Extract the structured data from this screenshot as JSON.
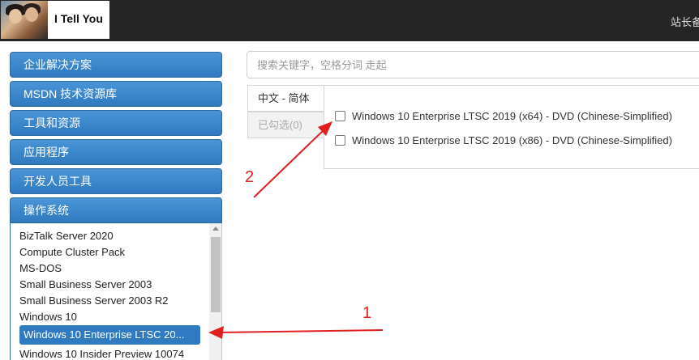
{
  "header": {
    "logo_text": "I Tell You",
    "right_text": "站长备"
  },
  "sidebar": {
    "categories": [
      {
        "label": "企业解决方案"
      },
      {
        "label": "MSDN 技术资源库"
      },
      {
        "label": "工具和资源"
      },
      {
        "label": "应用程序"
      },
      {
        "label": "开发人员工具"
      },
      {
        "label": "操作系统"
      }
    ],
    "os_list": [
      {
        "label": "BizTalk Server 2020"
      },
      {
        "label": "Compute Cluster Pack"
      },
      {
        "label": "MS-DOS"
      },
      {
        "label": "Small Business Server 2003"
      },
      {
        "label": "Small Business Server 2003 R2"
      },
      {
        "label": "Windows 10"
      },
      {
        "label": "Windows 10 Enterprise LTSC 20..."
      },
      {
        "label": "Windows 10 Insider Preview 10074"
      }
    ],
    "selected_index": 6
  },
  "search": {
    "placeholder": "搜索关键字，空格分词 走起"
  },
  "tabs": {
    "language": "中文 - 简体",
    "checked": "已勾选(0)"
  },
  "files": [
    {
      "label": "Windows 10 Enterprise LTSC 2019 (x64) - DVD (Chinese-Simplified)",
      "checked": false
    },
    {
      "label": "Windows 10 Enterprise LTSC 2019 (x86) - DVD (Chinese-Simplified)",
      "checked": false
    }
  ],
  "annotations": {
    "one": "1",
    "two": "2",
    "color": "#e02020"
  },
  "colors": {
    "accent": "#2f7ac0",
    "topbar": "#252525"
  }
}
